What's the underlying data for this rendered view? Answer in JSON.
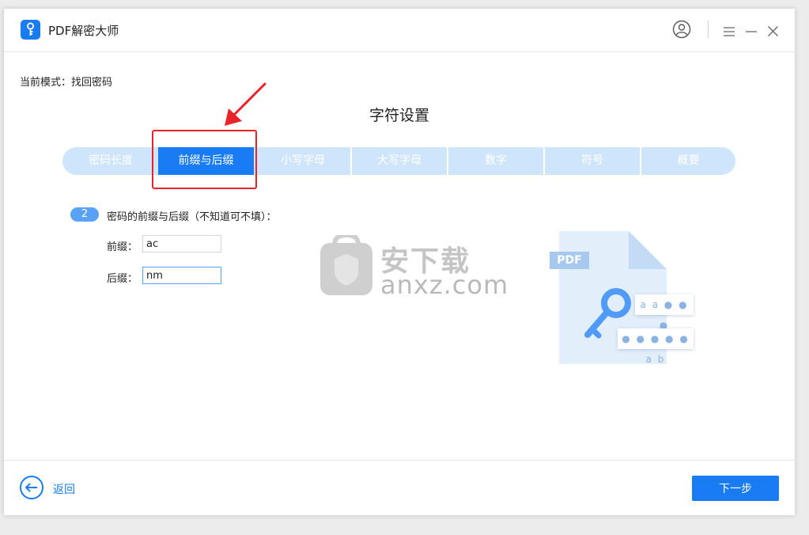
{
  "app": {
    "title": "PDF解密大师"
  },
  "mode": {
    "label": "当前模式：找回密码"
  },
  "page": {
    "title": "字符设置"
  },
  "steps": [
    {
      "label": "密码长度"
    },
    {
      "label": "前缀与后缀",
      "active": true
    },
    {
      "label": "小写字母"
    },
    {
      "label": "大写字母"
    },
    {
      "label": "数字"
    },
    {
      "label": "符号"
    },
    {
      "label": "概要"
    }
  ],
  "section": {
    "number": "2",
    "description": "密码的前缀与后缀（不知道可不填）："
  },
  "fields": {
    "prefix": {
      "label": "前缀：",
      "value": "ac"
    },
    "suffix": {
      "label": "后缀：",
      "value": "nm"
    }
  },
  "illustration": {
    "badge": "PDF",
    "chip1": "a a ● ● ●",
    "chip2": "● ● ● ● ● a b"
  },
  "watermark": {
    "cn": "安下载",
    "domain": "anxz.com"
  },
  "footer": {
    "back_label": "返回",
    "next_label": "下一步"
  },
  "colors": {
    "accent": "#1a7cf5",
    "step_bg": "#cfe5fb",
    "highlight": "#e8232a",
    "page_bg": "#ffffff"
  },
  "icons": [
    "app-logo-icon",
    "user-icon",
    "menu-icon",
    "minimize-icon",
    "close-icon",
    "back-arrow-icon",
    "key-icon",
    "red-arrow-annotation-icon"
  ]
}
